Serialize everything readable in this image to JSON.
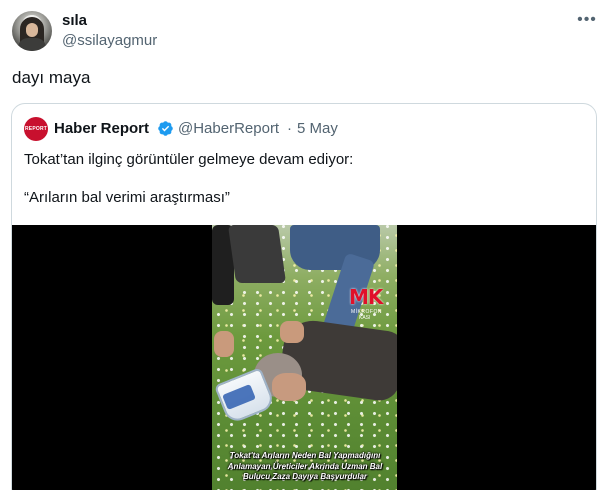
{
  "tweet": {
    "display_name": "sıla",
    "handle": "@ssilayagmur",
    "text": "dayı maya",
    "more_icon": "more-horizontal-icon"
  },
  "quote": {
    "avatar_label": "REPORT",
    "display_name": "Haber Report",
    "verified_icon": "verified-badge-icon",
    "verified_color": "#1d9bf0",
    "handle": "@HaberReport",
    "separator": "·",
    "time": "5 May",
    "line1": "Tokat’tan ilginç görüntüler gelmeye devam ediyor:",
    "line2": "“Arıların bal verimi araştırması”",
    "video": {
      "logo_text": "MK",
      "logo_sub": "MİKROFON",
      "logo_sub2": "KASI",
      "caption": "Tokat'ta Arıların Neden Bal Yapmadığını Anlamayan Üreticiler Akrinda Uzman Bal Bulucu Zaza Dayıya Başvurdular"
    }
  },
  "colors": {
    "text": "#0f1419",
    "secondary": "#536471",
    "border": "#cfd9de",
    "report_red": "#c8102e",
    "logo_red": "#e0102a"
  }
}
